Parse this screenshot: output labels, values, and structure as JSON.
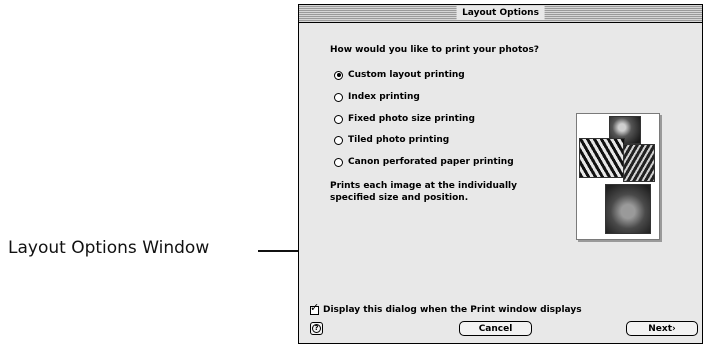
{
  "callout": {
    "label": "Layout Options Window"
  },
  "window": {
    "title": "Layout Options",
    "question": "How would you like to print your photos?",
    "options": [
      {
        "label": "Custom layout printing",
        "selected": true
      },
      {
        "label": "Index printing",
        "selected": false
      },
      {
        "label": "Fixed photo size printing",
        "selected": false
      },
      {
        "label": "Tiled photo printing",
        "selected": false
      },
      {
        "label": "Canon perforated paper printing",
        "selected": false
      }
    ],
    "description": "Prints each image at the individually specified size and position.",
    "checkbox": {
      "label": "Display this dialog when the Print window displays",
      "checked": true
    },
    "buttons": {
      "cancel": "Cancel",
      "next": "Next›",
      "help_glyph": "?"
    }
  }
}
